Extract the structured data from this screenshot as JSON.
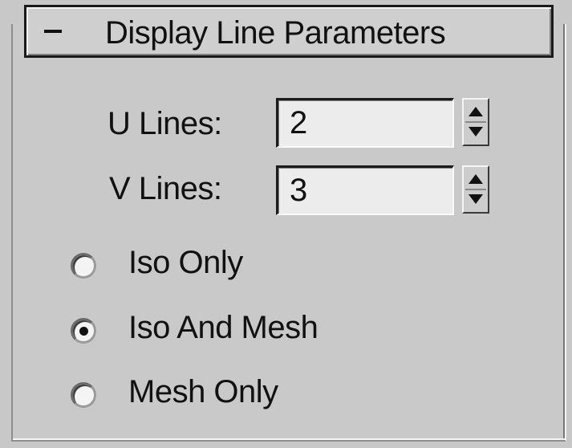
{
  "rollout": {
    "collapse_symbol": "-",
    "title": "Display Line Parameters"
  },
  "fields": {
    "u_lines": {
      "label": "U Lines:",
      "value": "2"
    },
    "v_lines": {
      "label": "V Lines:",
      "value": "3"
    }
  },
  "display_mode": {
    "options": [
      {
        "label": "Iso Only",
        "selected": false
      },
      {
        "label": "Iso And Mesh",
        "selected": true
      },
      {
        "label": "Mesh Only",
        "selected": false
      }
    ]
  }
}
